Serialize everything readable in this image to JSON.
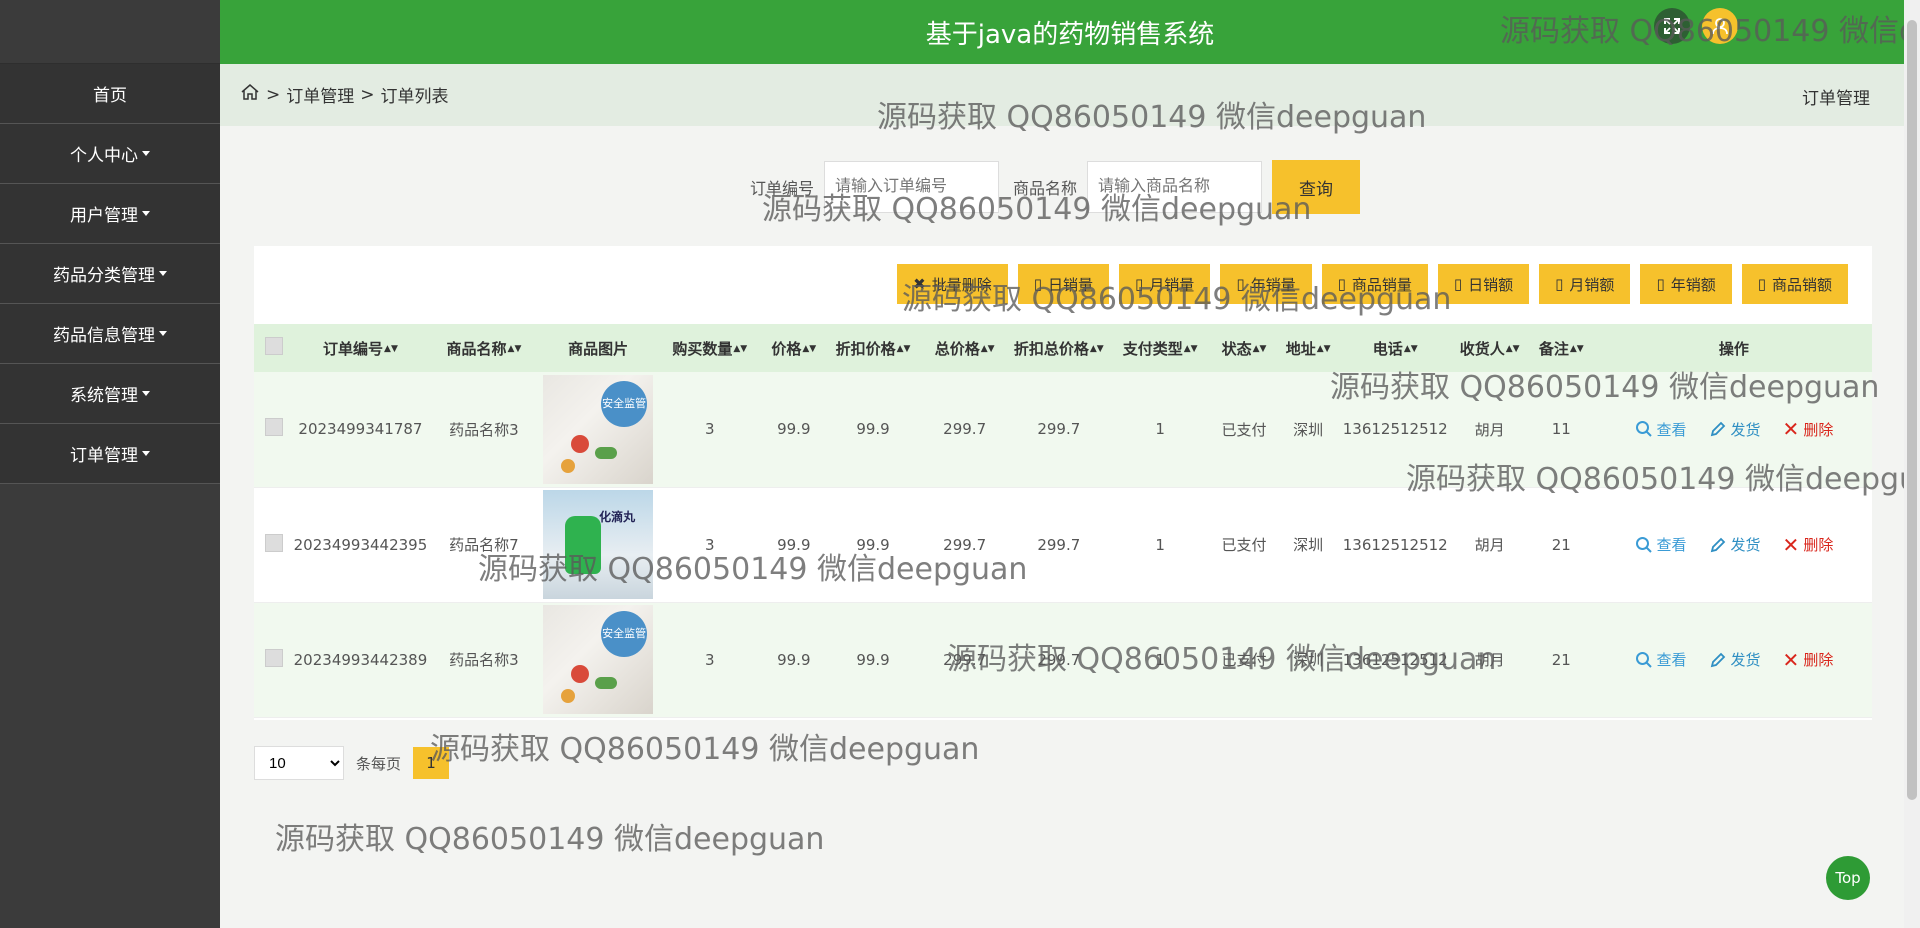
{
  "app": {
    "title": "基于java的药物销售系统"
  },
  "sidebar": {
    "items": [
      {
        "label": "首页",
        "has_caret": false
      },
      {
        "label": "个人中心",
        "has_caret": true
      },
      {
        "label": "用户管理",
        "has_caret": true
      },
      {
        "label": "药品分类管理",
        "has_caret": true
      },
      {
        "label": "药品信息管理",
        "has_caret": true
      },
      {
        "label": "系统管理",
        "has_caret": true
      },
      {
        "label": "订单管理",
        "has_caret": true
      }
    ]
  },
  "breadcrumb": {
    "home_icon": "home-icon",
    "sep": ">",
    "level1": "订单管理",
    "level2": "订单列表",
    "right": "订单管理"
  },
  "search": {
    "order_no_label": "订单编号",
    "order_no_placeholder": "请输入订单编号",
    "product_label": "商品名称",
    "product_placeholder": "请输入商品名称",
    "query_button": "查询"
  },
  "toolbar": {
    "buttons": [
      "批量删除",
      "日销量",
      "月销量",
      "年销量",
      "商品销量",
      "日销额",
      "月销额",
      "年销额",
      "商品销额"
    ]
  },
  "table": {
    "headers": [
      "订单编号",
      "商品名称",
      "商品图片",
      "购买数量",
      "价格",
      "折扣价格",
      "总价格",
      "折扣总价格",
      "支付类型",
      "状态",
      "地址",
      "电话",
      "收货人",
      "备注",
      "操作"
    ],
    "rows": [
      {
        "order_no": "2023499341787",
        "product": "药品名称3",
        "image_label": "安全监管",
        "qty": "3",
        "price": "99.9",
        "discount_price": "99.9",
        "total": "299.7",
        "discount_total": "299.7",
        "pay_type": "1",
        "status": "已支付",
        "address": "深圳",
        "phone": "13612512512",
        "receiver": "胡月",
        "note": "11"
      },
      {
        "order_no": "20234993442395",
        "product": "药品名称7",
        "image_label": "化滴丸",
        "qty": "3",
        "price": "99.9",
        "discount_price": "99.9",
        "total": "299.7",
        "discount_total": "299.7",
        "pay_type": "1",
        "status": "已支付",
        "address": "深圳",
        "phone": "13612512512",
        "receiver": "胡月",
        "note": "21"
      },
      {
        "order_no": "20234993442389",
        "product": "药品名称3",
        "image_label": "安全监管",
        "qty": "3",
        "price": "99.9",
        "discount_price": "99.9",
        "total": "299.7",
        "discount_total": "299.7",
        "pay_type": "1",
        "status": "已支付",
        "address": "深圳",
        "phone": "13612512512",
        "receiver": "胡月",
        "note": "21"
      }
    ],
    "actions": {
      "view": "查看",
      "ship": "发货",
      "delete": "删除"
    }
  },
  "pager": {
    "page_size": "10",
    "per_page_label": "条每页",
    "current_page": "1"
  },
  "top_button": "Top",
  "watermark_text": "源码获取 QQ86050149 微信deepguan",
  "watermark_text_cut": "源码获取 QQ86050149 微信de",
  "colors": {
    "header": "#38a33a",
    "sidebar": "#3b3b3b",
    "accent": "#f6c12c",
    "delete": "#d9261c",
    "link": "#3a9bd5"
  }
}
